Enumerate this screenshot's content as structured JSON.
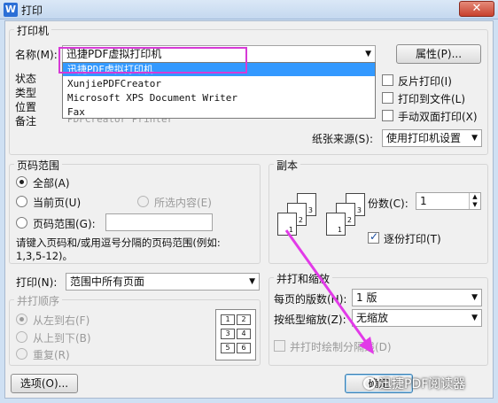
{
  "window": {
    "app_icon": "W",
    "title": "打印",
    "close": "✕"
  },
  "printer": {
    "group_label": "打印机",
    "name_label": "名称(M):",
    "name_value": "迅捷PDF虚拟打印机",
    "properties_button": "属性(P)...",
    "status_label": "状态",
    "type_label": "类型",
    "location_label": "位置",
    "note_label": "备注",
    "note_value": "PDFCreator Printer",
    "dropdown_options": [
      "迅捷PDF虚拟打印机",
      "XunjiePDFCreator",
      "Microsoft XPS Document Writer",
      "Fax"
    ],
    "reverse_print": "反片打印(I)",
    "print_to_file": "打印到文件(L)",
    "manual_duplex": "手动双面打印(X)",
    "paper_source_label": "纸张来源(S):",
    "paper_source_value": "使用打印机设置"
  },
  "page_range": {
    "group_label": "页码范围",
    "all": "全部(A)",
    "current": "当前页(U)",
    "selection": "所选内容(E)",
    "range": "页码范围(G):",
    "hint": "请键入页码和/或用逗号分隔的页码范围(例如:",
    "hint2": "1,3,5-12)。"
  },
  "copies": {
    "group_label": "副本",
    "count_label": "份数(C):",
    "count_value": "1",
    "collate": "逐份打印(T)",
    "page_nums": [
      "3",
      "2",
      "1",
      "3",
      "2",
      "1"
    ]
  },
  "print_what": {
    "label": "打印(N):",
    "value": "范围中所有页面"
  },
  "order": {
    "group_label": "并打顺序",
    "ltr": "从左到右(F)",
    "ttb": "从上到下(B)",
    "repeat": "重复(R)",
    "grid": [
      "1",
      "2",
      "3",
      "4",
      "5",
      "6"
    ]
  },
  "zoom": {
    "group_label": "并打和缩放",
    "pages_per_sheet_label": "每页的版数(H):",
    "pages_per_sheet_value": "1 版",
    "scale_label": "按纸型缩放(Z):",
    "scale_value": "无缩放",
    "draw_borders": "并打时绘制分隔线(D)"
  },
  "buttons": {
    "options": "选项(O)...",
    "ok": "确定"
  },
  "watermark": "迅捷PDF阅读器",
  "colors": {
    "highlight": "#d63ad6",
    "arrow": "#e23ae8",
    "selection": "#3399ff"
  }
}
